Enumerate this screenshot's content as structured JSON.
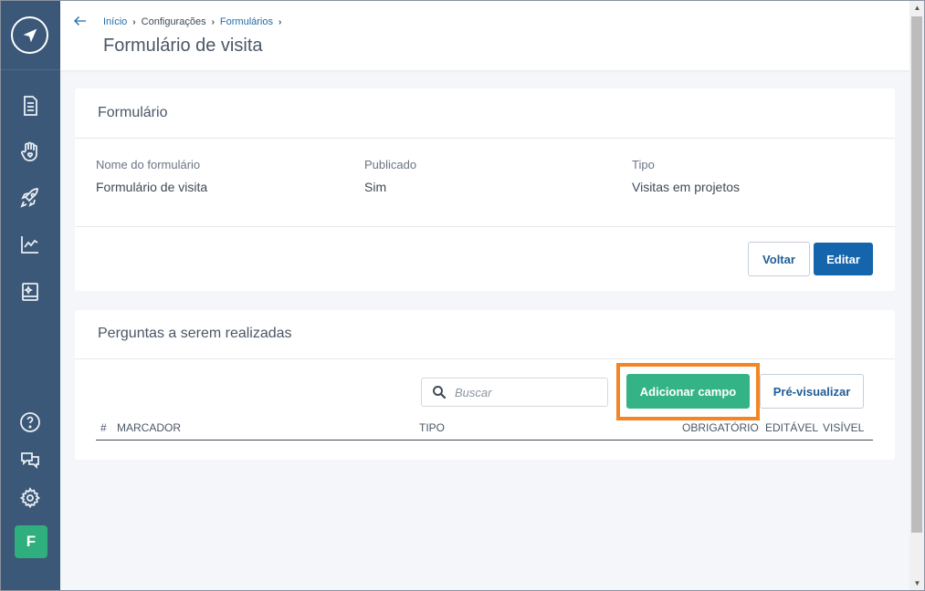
{
  "sidebar": {
    "icons": [
      "compass-logo-icon",
      "document-icon",
      "hand-heart-icon",
      "rocket-icon",
      "chart-line-icon",
      "photo-book-icon",
      "help-icon",
      "chat-icon",
      "gear-icon"
    ],
    "avatar_letter": "F",
    "avatar_color": "#2fae7e",
    "background": "#3b5878"
  },
  "header": {
    "breadcrumb": [
      "Início",
      "Configurações",
      "Formulários"
    ],
    "title": "Formulário de visita"
  },
  "form_card": {
    "title": "Formulário",
    "fields": [
      {
        "label": "Nome do formulário",
        "value": "Formulário de visita"
      },
      {
        "label": "Publicado",
        "value": "Sim"
      },
      {
        "label": "Tipo",
        "value": "Visitas em projetos"
      }
    ],
    "back_button": "Voltar",
    "edit_button": "Editar"
  },
  "questions_card": {
    "title": "Perguntas a serem realizadas",
    "search_placeholder": "Buscar",
    "add_field_button": "Adicionar campo",
    "preview_button": "Pré-visualizar",
    "columns": [
      "#",
      "MARCADOR",
      "TIPO",
      "OBRIGATÓRIO",
      "EDITÁVEL",
      "VISÍVEL"
    ]
  },
  "colors": {
    "primary": "#1565ac",
    "success": "#34b486",
    "highlight": "#f58425"
  }
}
